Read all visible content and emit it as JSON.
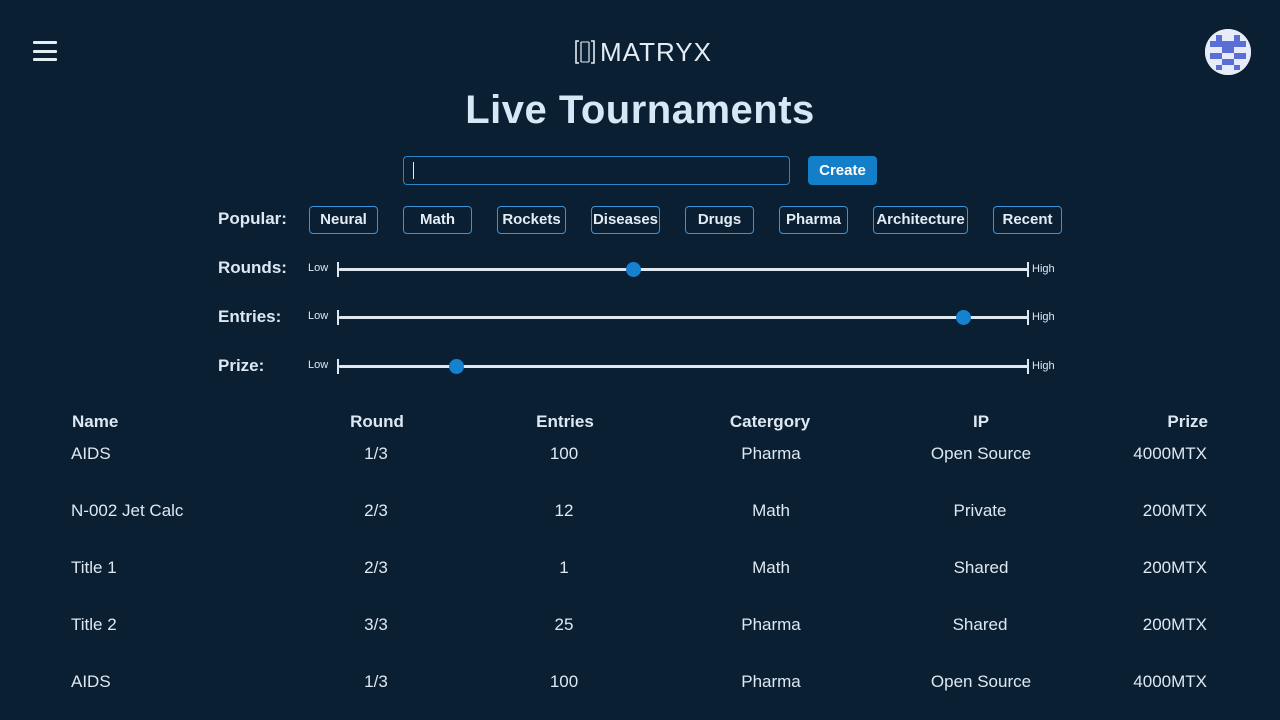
{
  "header": {
    "logo_text": "MATRYX",
    "menu_icon": "hamburger-menu-icon",
    "avatar_icon": "user-avatar-icon"
  },
  "page_title": "Live Tournaments",
  "search": {
    "value": "",
    "placeholder": ""
  },
  "create_button": "Create",
  "popular": {
    "label": "Popular:",
    "tags": [
      "Neural",
      "Math",
      "Rockets",
      "Diseases",
      "Drugs",
      "Pharma",
      "Architecture",
      "Recent"
    ]
  },
  "sliders": [
    {
      "label": "Rounds:",
      "low": "Low",
      "high": "High",
      "value": 0.426
    },
    {
      "label": "Entries:",
      "low": "Low",
      "high": "High",
      "value": 0.905
    },
    {
      "label": "Prize:",
      "low": "Low",
      "high": "High",
      "value": 0.169
    }
  ],
  "table": {
    "columns": {
      "name": "Name",
      "round": "Round",
      "entries": "Entries",
      "category": "Catergory",
      "ip": "IP",
      "prize": "Prize"
    },
    "rows": [
      {
        "name": "AIDS",
        "round": "1/3",
        "entries": "100",
        "category": "Pharma",
        "ip": "Open Source",
        "prize": "4000MTX"
      },
      {
        "name": "N-002 Jet Calc",
        "round": "2/3",
        "entries": "12",
        "category": "Math",
        "ip": "Private",
        "prize": "200MTX"
      },
      {
        "name": "Title 1",
        "round": "2/3",
        "entries": "1",
        "category": "Math",
        "ip": "Shared",
        "prize": "200MTX"
      },
      {
        "name": "Title 2",
        "round": "3/3",
        "entries": "25",
        "category": "Pharma",
        "ip": "Shared",
        "prize": "200MTX"
      },
      {
        "name": "AIDS",
        "round": "1/3",
        "entries": "100",
        "category": "Pharma",
        "ip": "Open Source",
        "prize": "4000MTX"
      }
    ]
  },
  "colors": {
    "background": "#0b1f33",
    "accent": "#137fc9",
    "tag_border": "#3a93d6",
    "text": "#dde8f2"
  }
}
